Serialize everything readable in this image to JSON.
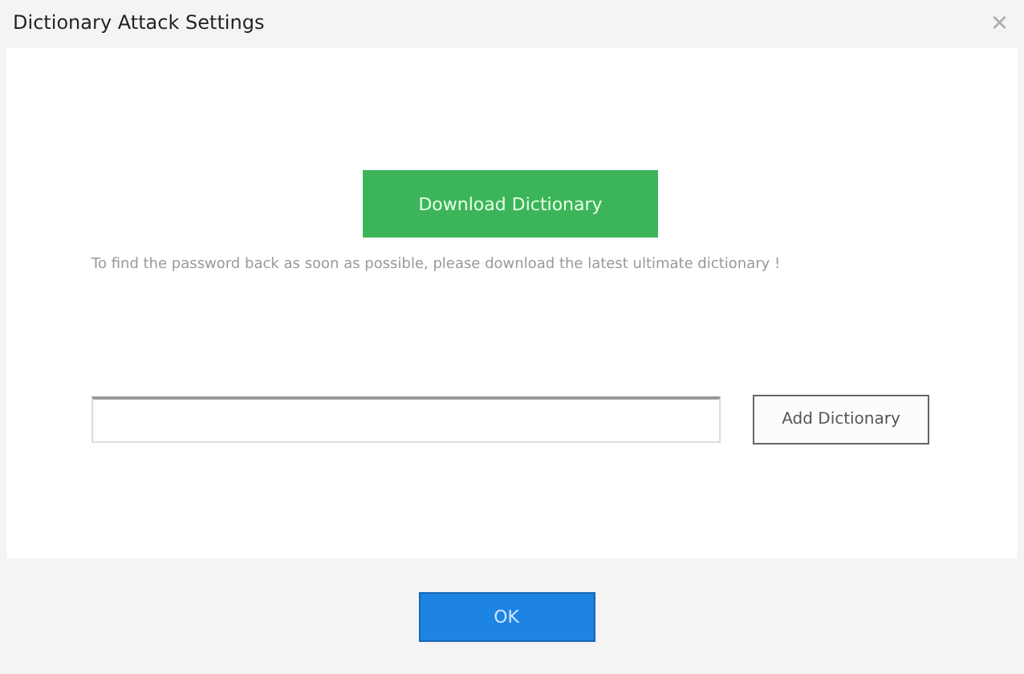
{
  "window": {
    "title": "Dictionary Attack Settings",
    "close": "×"
  },
  "download_button": "Download Dictionary",
  "hint": "To find the password back as soon as possible, please download the latest ultimate dictionary !",
  "add_button": "Add Dictionary",
  "ok_button": "OK"
}
